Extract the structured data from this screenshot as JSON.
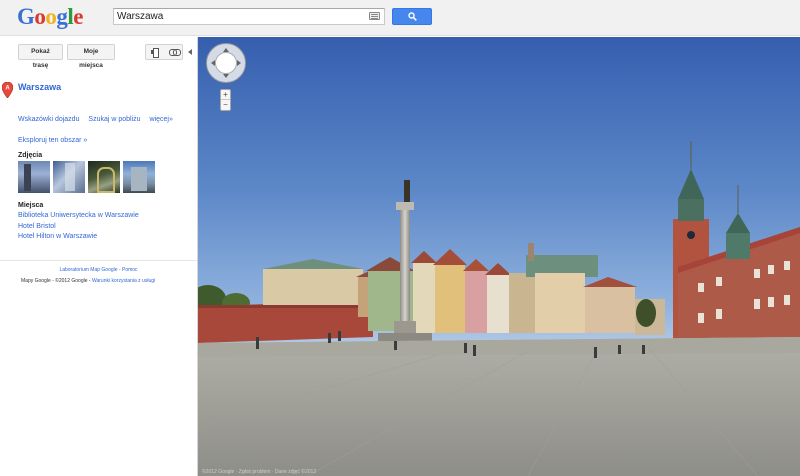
{
  "header": {
    "logo_letters": [
      "G",
      "o",
      "o",
      "g",
      "l",
      "e"
    ],
    "search_value": "Warszawa",
    "search_icon": "search-icon",
    "keyboard_icon": "keyboard-icon",
    "accent": "#4787ed"
  },
  "sidebar": {
    "route_button": "Pokaż trasę",
    "myplaces_button": "Moje miejsca",
    "print_icon": "print-icon",
    "link_icon": "link-icon",
    "place_title": "Warszawa",
    "marker_letter": "A",
    "actions": [
      "Wskazówki dojazdu",
      "Szukaj w pobliżu",
      "więcej»"
    ],
    "explore_link": "Eksploruj ten obszar »",
    "photos_title": "Zdjęcia",
    "places_title": "Miejsca",
    "places": [
      "Biblioteka Uniwersytecka w Warszawie",
      "Hotel Bristol",
      "Hotel Hilton w Warszawie"
    ],
    "footer_link1": "Laboratorium Map Google",
    "footer_sep": " - ",
    "footer_link2": "Pomoc",
    "footer_text": "Mapy Google - ©2012 Google - ",
    "footer_terms": "Warunki korzystania z usługi"
  },
  "streetview": {
    "zoom_in": "+",
    "zoom_out": "−",
    "copyright": "©2012 Google · Zgłoś problem · Dane zdjęć ©2012"
  }
}
